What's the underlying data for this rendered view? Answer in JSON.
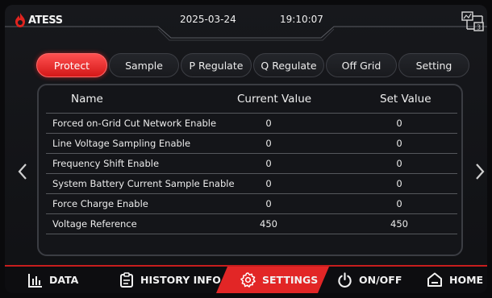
{
  "header": {
    "brand": "ATESS",
    "date": "2025-03-24",
    "time": "19:10:07",
    "network_badge": "3",
    "brand_color": "#e0241f"
  },
  "tabs": [
    {
      "label": "Protect",
      "active": true
    },
    {
      "label": "Sample",
      "active": false
    },
    {
      "label": "P Regulate",
      "active": false
    },
    {
      "label": "Q Regulate",
      "active": false
    },
    {
      "label": "Off Grid",
      "active": false
    },
    {
      "label": "Setting",
      "active": false
    }
  ],
  "table": {
    "columns": [
      "Name",
      "Current Value",
      "Set Value"
    ],
    "rows": [
      {
        "name": "Forced on-Grid Cut Network Enable",
        "current": "0",
        "set": "0"
      },
      {
        "name": "Line Voltage Sampling Enable",
        "current": "0",
        "set": "0"
      },
      {
        "name": "Frequency Shift Enable",
        "current": "0",
        "set": "0"
      },
      {
        "name": "System Battery Current  Sample Enable",
        "current": "0",
        "set": "0"
      },
      {
        "name": "Force Charge Enable",
        "current": "0",
        "set": "0"
      },
      {
        "name": "Voltage Reference",
        "current": "450",
        "set": "450"
      }
    ]
  },
  "nav": {
    "data_label": "DATA",
    "history_label": "HISTORY INFO",
    "settings_label": "SETTINGS",
    "onoff_label": "ON/OFF",
    "home_label": "HOME",
    "active": "settings",
    "accent": "#e22626"
  },
  "icons": {
    "prev": "chevron-left-icon",
    "next": "chevron-right-icon",
    "data": "bar-chart-icon",
    "history": "clipboard-icon",
    "settings": "gear-icon",
    "onoff": "power-icon",
    "home": "home-icon",
    "network": "network-icon"
  }
}
